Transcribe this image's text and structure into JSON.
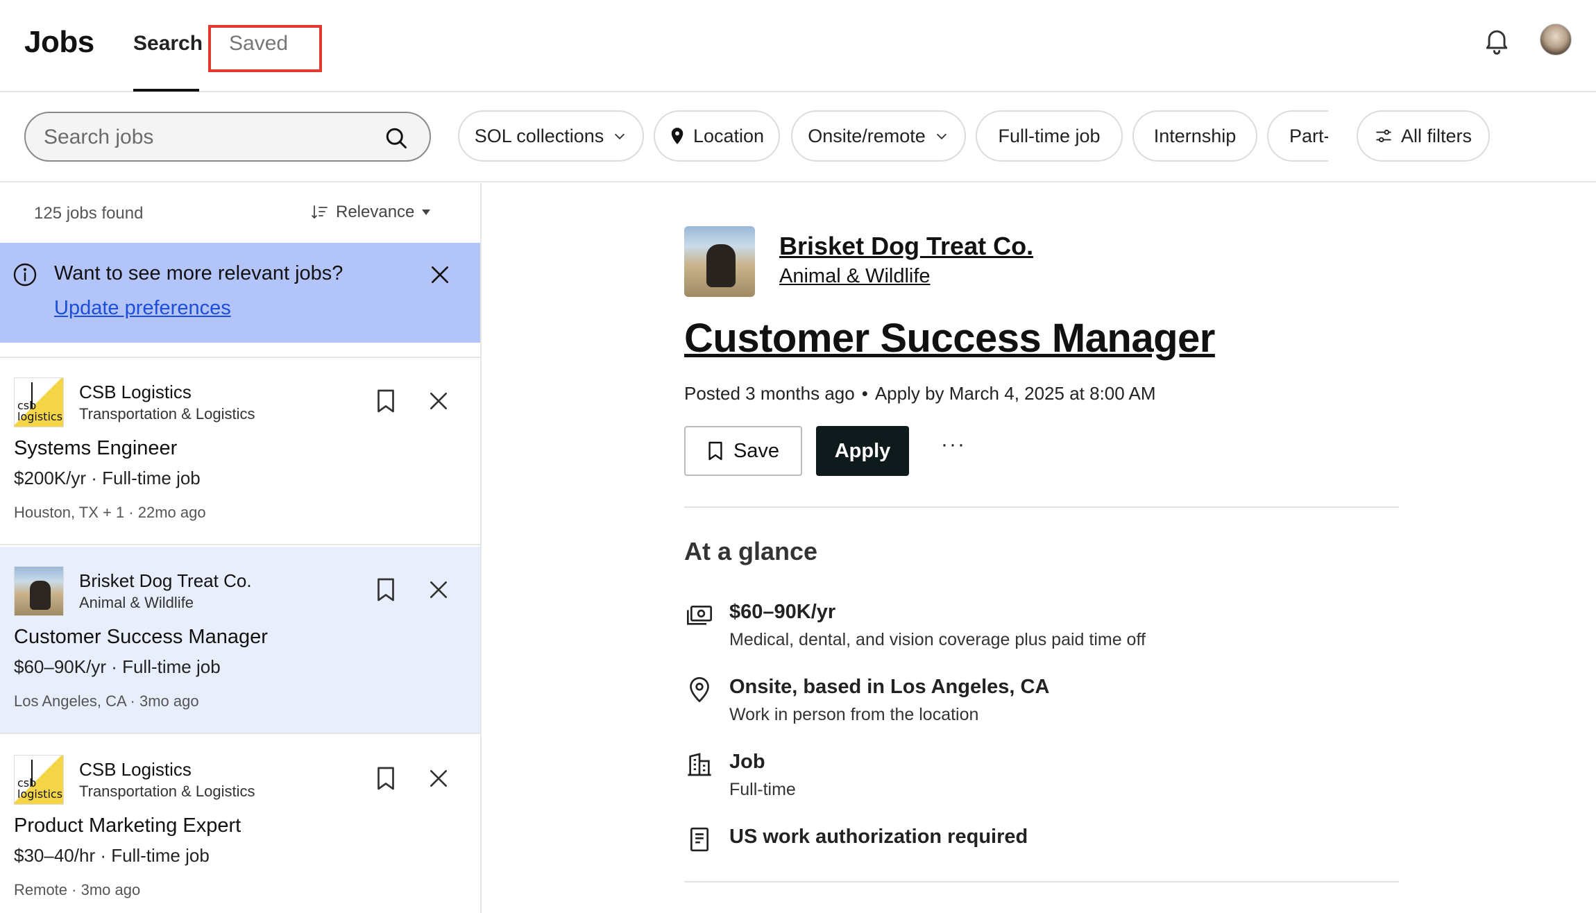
{
  "header": {
    "logo": "Jobs",
    "tabs": [
      {
        "label": "Search",
        "active": true
      },
      {
        "label": "Saved",
        "active": false
      }
    ]
  },
  "filters": {
    "search_placeholder": "Search jobs",
    "chips": [
      "SOL collections",
      "Location",
      "Onsite/remote",
      "Full-time job",
      "Internship",
      "Part-",
      "All filters"
    ]
  },
  "results": {
    "count_text": "125 jobs found",
    "sort_label": "Relevance"
  },
  "banner": {
    "title": "Want to see more relevant jobs?",
    "link": "Update preferences"
  },
  "jobs": [
    {
      "company": "CSB Logistics",
      "industry": "Transportation & Logistics",
      "title": "Systems Engineer",
      "pay": "$200K/yr · Full-time job",
      "meta": "Houston, TX + 1 · 22mo ago",
      "logo_text": "csb logistics",
      "selected": false
    },
    {
      "company": "Brisket Dog Treat Co.",
      "industry": "Animal & Wildlife",
      "title": "Customer Success Manager",
      "pay": "$60–90K/yr · Full-time job",
      "meta": "Los Angeles, CA · 3mo ago",
      "selected": true
    },
    {
      "company": "CSB Logistics",
      "industry": "Transportation & Logistics",
      "title": "Product Marketing Expert",
      "pay": "$30–40/hr · Full-time job",
      "meta": "Remote · 3mo ago",
      "logo_text": "csb logistics",
      "selected": false
    }
  ],
  "detail": {
    "company": "Brisket Dog Treat Co.",
    "industry": "Animal & Wildlife",
    "title": "Customer Success Manager",
    "posted": "Posted 3 months ago",
    "apply_by": "Apply by March 4, 2025 at 8:00 AM",
    "save_label": "Save",
    "apply_label": "Apply",
    "more_label": "···",
    "glance_title": "At a glance",
    "glance": [
      {
        "icon": "money-icon",
        "title": "$60–90K/yr",
        "sub": "Medical, dental, and vision coverage plus paid time off"
      },
      {
        "icon": "location-pin-icon",
        "title": "Onsite, based in Los Angeles, CA",
        "sub": "Work in person from the location"
      },
      {
        "icon": "building-icon",
        "title": "Job",
        "sub": "Full-time"
      },
      {
        "icon": "document-icon",
        "title": "US work authorization required",
        "sub": ""
      }
    ]
  },
  "colors": {
    "banner_bg": "#b3c4f8",
    "selected_card_bg": "#e8eefc",
    "apply_bg": "#0e1a1c",
    "highlight_box": "#e23b2e",
    "link": "#1d4ed8"
  }
}
